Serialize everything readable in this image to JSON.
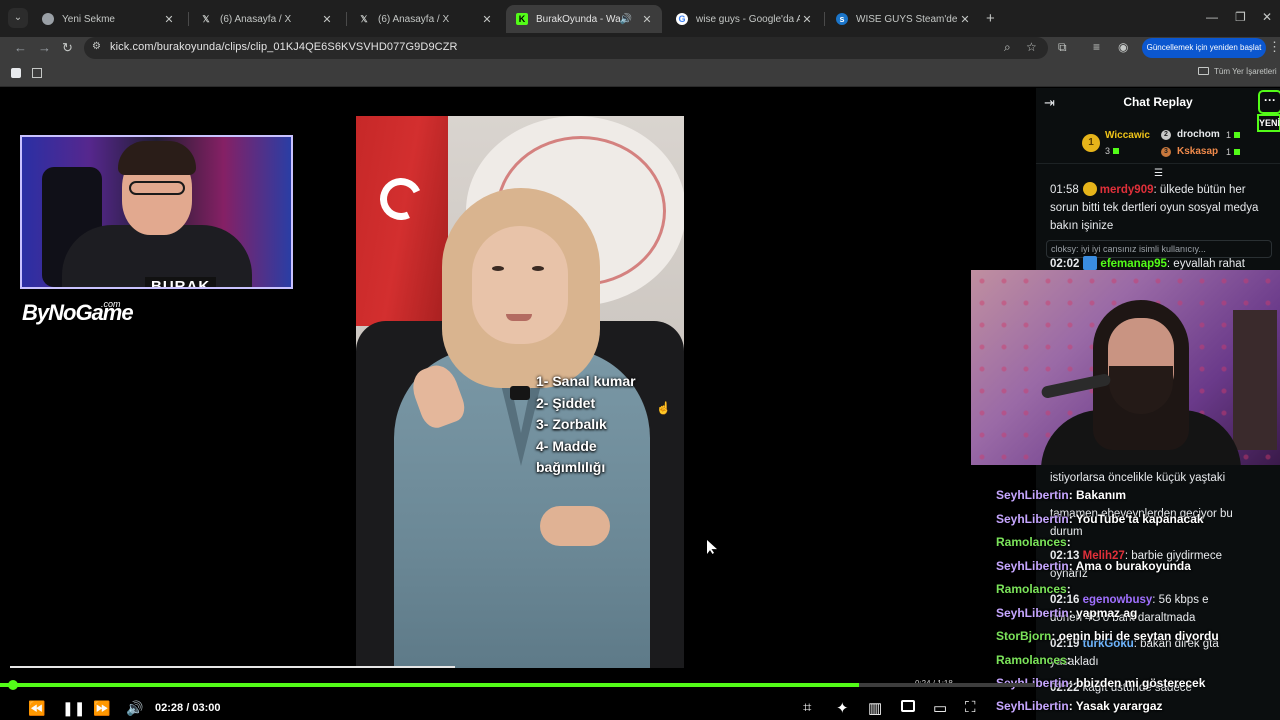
{
  "browser": {
    "tabs": [
      {
        "title": "Yeni Sekme",
        "icon": "chrome-icon"
      },
      {
        "title": "(6) Anasayfa / X",
        "icon": "x-icon"
      },
      {
        "title": "(6) Anasayfa / X",
        "icon": "x-icon"
      },
      {
        "title": "BurakOyunda - Watch clips",
        "icon": "kick-icon",
        "active": true,
        "audio": true
      },
      {
        "title": "wise guys - Google'da Ara",
        "icon": "google-icon"
      },
      {
        "title": "WISE GUYS Steam'de",
        "icon": "steam-icon"
      }
    ],
    "url": "kick.com/burakoyunda/clips/clip_01KJ4QE6S6KVSVHD077G9D9CZR",
    "update_button": "Güncellemek için yeniden başlat",
    "all_bookmarks": "Tüm Yer İşaretleri"
  },
  "video": {
    "streamer_tag": "BURAK",
    "brand": "ByNoGame",
    "brand_suffix": ".com",
    "overlay_list": [
      "1- Sanal kumar",
      "2- Şiddet",
      "3- Zorbalık",
      "4- Madde",
      "bağımlılığı"
    ]
  },
  "chat": {
    "title": "Chat Replay",
    "new_badge": "YENİ",
    "top_gifters": [
      {
        "rank": "1",
        "name": "Wiccawic",
        "count": "3",
        "color": "#f0c419"
      },
      {
        "rank": "2",
        "name": "drochom",
        "count": "1",
        "color": "#e8eaed"
      },
      {
        "rank": "3",
        "name": "Kskasap",
        "count": "1",
        "color": "#f08a4b"
      }
    ],
    "messages": [
      {
        "time": "01:58",
        "user": "merdy909",
        "color": "#e0303a",
        "text": ": ülkede bütün her sorun bitti tek dertleri oyun sosyal medya bakın işinize"
      },
      {
        "time": "02:02",
        "user": "efemanap95",
        "color": "#53fc18",
        "text": ": eyvallah rahat"
      }
    ],
    "reply_preview": "cloksy: iyi iyi cansınız",
    "reply_preview_user": "isimli kullanıcıy...",
    "background_lines": [
      "istiyorlarsa öncelikle küçük yaştaki",
      "tamamen ebeveynlerden geçiyor bu",
      "durum",
      "barbie giydirmece",
      "oynarız",
      "56 kbps e",
      "dönen 4G'o bant daraltmada",
      "bakan direk gta",
      "yasakladı",
      "kağıt üstünde sadece"
    ],
    "background_meta": [
      {
        "time": "02:13",
        "user": "Melih27",
        "color": "#e0303a"
      },
      {
        "time": "02:16",
        "user": "egenowbusy",
        "color": "#a070ff"
      },
      {
        "time": "02:19",
        "user": "turkGoku",
        "color": "#6fb6ff"
      },
      {
        "time": "02:22",
        "user": "",
        "color": "#e0303a"
      }
    ],
    "overlay_messages": [
      {
        "user": "SeyhLibertin",
        "user_color": "#c6a6ff",
        "text": ": Bakanım"
      },
      {
        "user": "SeyhLibertin",
        "user_color": "#c6a6ff",
        "text": ": YouTube'ta kapanacak"
      },
      {
        "user": "Ramolances",
        "user_color": "#7be35a",
        "text": ":"
      },
      {
        "user": "SeyhLibertin",
        "user_color": "#c6a6ff",
        "text": ": Ama o burakoyunda"
      },
      {
        "user": "Ramolances",
        "user_color": "#7be35a",
        "text": ":"
      },
      {
        "user": "SeyhLibertin",
        "user_color": "#c6a6ff",
        "text": ": yapmaz ag"
      },
      {
        "user": "StorBjorn",
        "user_color": "#7be35a",
        "text": ": oenin biri de seytan diyordu"
      },
      {
        "user": "Ramolances",
        "user_color": "#7be35a",
        "text": ":"
      },
      {
        "user": "SeyhLibertin",
        "user_color": "#c6a6ff",
        "text": ": bbizden mi gösterecek"
      },
      {
        "user": "SeyhLibertin",
        "user_color": "#c6a6ff",
        "text": ": Yasak yarargaz"
      }
    ]
  },
  "player": {
    "current_time": "02:28",
    "separator": "/",
    "duration": "03:00",
    "progress_fraction": 0.83,
    "inner_time": "0:24 / 1:18",
    "accent": "#53fc18"
  }
}
